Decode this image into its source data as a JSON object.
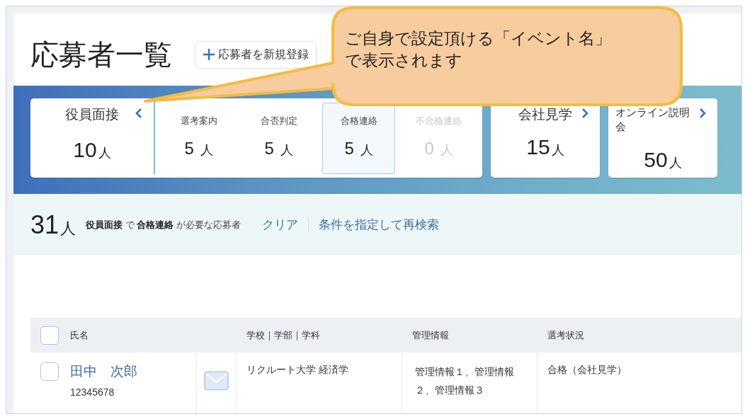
{
  "title": "応募者一覧",
  "new_button": {
    "label": "応募者を新規登録"
  },
  "event_cards": [
    {
      "kind": "expanded",
      "name": "役員面接",
      "count": "10",
      "unit": "人",
      "stages": [
        {
          "label": "選考案内",
          "count": "5",
          "unit": "人",
          "selected": false,
          "disabled": false
        },
        {
          "label": "合否判定",
          "count": "5",
          "unit": "人",
          "selected": false,
          "disabled": false
        },
        {
          "label": "合格連絡",
          "count": "5",
          "unit": "人",
          "selected": true,
          "disabled": false
        },
        {
          "label": "不合格連絡",
          "count": "0",
          "unit": "人",
          "selected": false,
          "disabled": true
        }
      ]
    },
    {
      "kind": "collapsed",
      "name": "会社見学",
      "count": "15",
      "unit": "人"
    },
    {
      "kind": "collapsed",
      "name": "オンライン説明会",
      "count": "50",
      "unit": "人"
    }
  ],
  "summary": {
    "count": "31",
    "unit": "人",
    "text": "**役員面接** で **合格連絡** が必要な応募者",
    "links": [
      "クリア",
      "条件を指定して再検索"
    ]
  },
  "table": {
    "all_checked": false,
    "columns": [
      "氏名",
      "学校｜学部｜学科",
      "管理情報",
      "選考状況"
    ],
    "rows": [
      {
        "checked": false,
        "name": "田中　次郎",
        "id": "12345678",
        "school": "リクルート大学 経済学",
        "management": "管理情報１、管理情報２、管理情報３",
        "status": "合格（会社見学）"
      }
    ]
  },
  "callout": {
    "lines": [
      "ご自身で設定頂ける「イベント名」",
      "で表示されます"
    ]
  }
}
